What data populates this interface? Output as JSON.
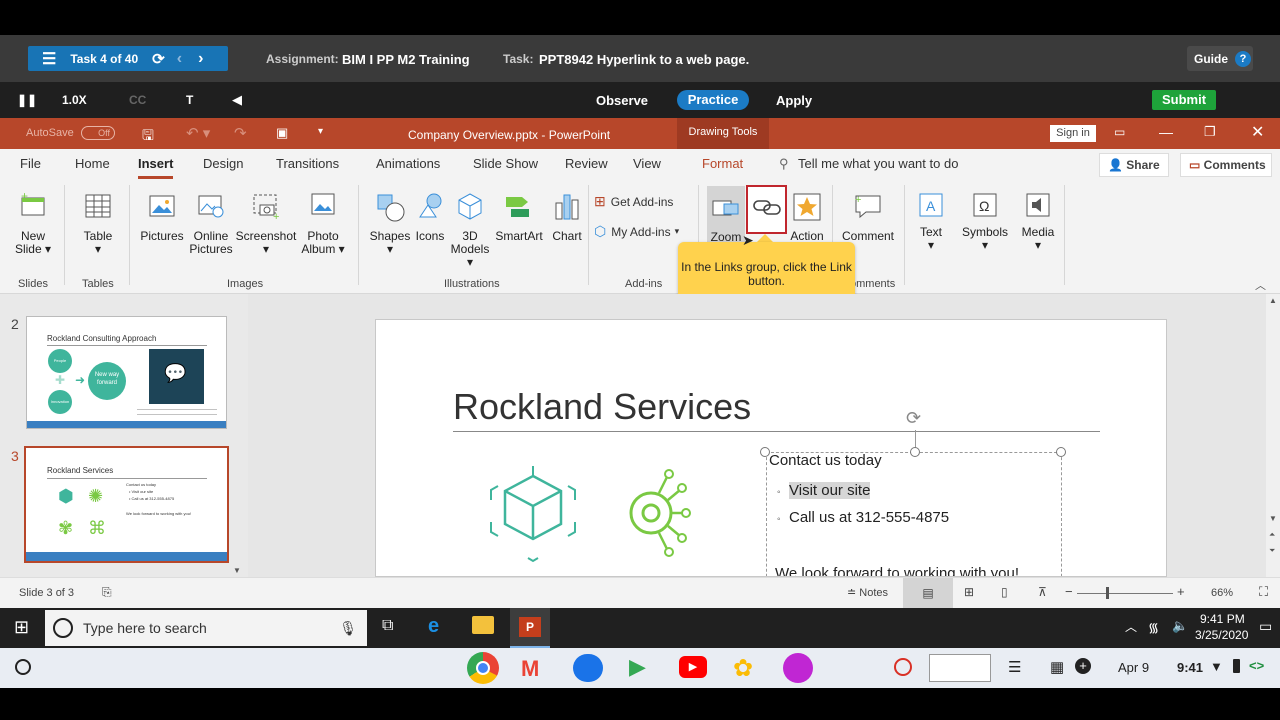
{
  "sim": {
    "task_label": "Task 4 of 40",
    "assignment_label": "Assignment:",
    "assignment_value": "BIM I PP M2 Training",
    "task_name_label": "Task:",
    "task_name_value": "PPT8942 Hyperlink to a web page.",
    "guide": "Guide",
    "help": "?",
    "speed": "1.0X",
    "cc": "CC",
    "text_t": "T",
    "observe": "Observe",
    "practice": "Practice",
    "apply": "Apply",
    "submit": "Submit"
  },
  "titlebar": {
    "autosave": "AutoSave",
    "off": "Off",
    "title": "Company Overview.pptx - PowerPoint",
    "drawing_tools": "Drawing Tools",
    "signin": "Sign in"
  },
  "menu": {
    "file": "File",
    "home": "Home",
    "insert": "Insert",
    "design": "Design",
    "transitions": "Transitions",
    "animations": "Animations",
    "slideshow": "Slide Show",
    "review": "Review",
    "view": "View",
    "format": "Format",
    "tellme": "Tell me what you want to do",
    "share": "Share",
    "comments": "Comments"
  },
  "ribbon": {
    "new_slide_1": "New",
    "new_slide_2": "Slide ▾",
    "table_1": "Table",
    "table_2": "▾",
    "pictures": "Pictures",
    "online_1": "Online",
    "online_2": "Pictures",
    "screenshot_1": "Screenshot",
    "screenshot_2": "▾",
    "photo_1": "Photo",
    "photo_2": "Album ▾",
    "shapes_1": "Shapes",
    "shapes_2": "▾",
    "icons": "Icons",
    "models_1": "3D",
    "models_2": "Models ▾",
    "smartart": "SmartArt",
    "chart": "Chart",
    "get_addins": "Get Add-ins",
    "my_addins": "My Add-ins",
    "zoom": "Zoom",
    "action": "Action",
    "comment": "Comment",
    "text_1": "Text",
    "text_2": "▾",
    "symbols_1": "Symbols",
    "symbols_2": "▾",
    "media_1": "Media",
    "media_2": "▾",
    "grp_slides": "Slides",
    "grp_tables": "Tables",
    "grp_images": "Images",
    "grp_illus": "Illustrations",
    "grp_addins": "Add-ins",
    "grp_comments": "omments"
  },
  "tooltip": "In the Links group, click the Link button.",
  "slides": {
    "num2": "2",
    "num3": "3",
    "t2_title": "Rockland Consulting Approach",
    "t2_c1": "People",
    "t2_c2": "Innovation",
    "t2_center": "New way forward",
    "t3_title": "Rockland Services",
    "t3_l1": "Contact us today",
    "t3_l2": "• Visit our site",
    "t3_l3": "• Call us at 312-555-4875",
    "t3_l4": "We look forward to working with you!"
  },
  "slide": {
    "title": "Rockland Services",
    "contact": "Contact us today",
    "bullet1": "Visit our site",
    "bullet2": "Call us at 312-555-4875",
    "closing": "We look forward to working with you!"
  },
  "status": {
    "slide_of": "Slide 3 of 3",
    "notes": "Notes",
    "zoom": "66%"
  },
  "windows": {
    "search": "Type here to search",
    "time": "9:41 PM",
    "date": "3/25/2020"
  },
  "shelf": {
    "date": "Apr 9",
    "time": "9:41"
  },
  "colors": {
    "ppt_red": "#b7472a",
    "teal": "#3fb59c",
    "green": "#7ac943",
    "accent_blue": "#1b7bc5",
    "submit_green": "#1ea33a",
    "tooltip_yellow": "#ffd24d"
  }
}
